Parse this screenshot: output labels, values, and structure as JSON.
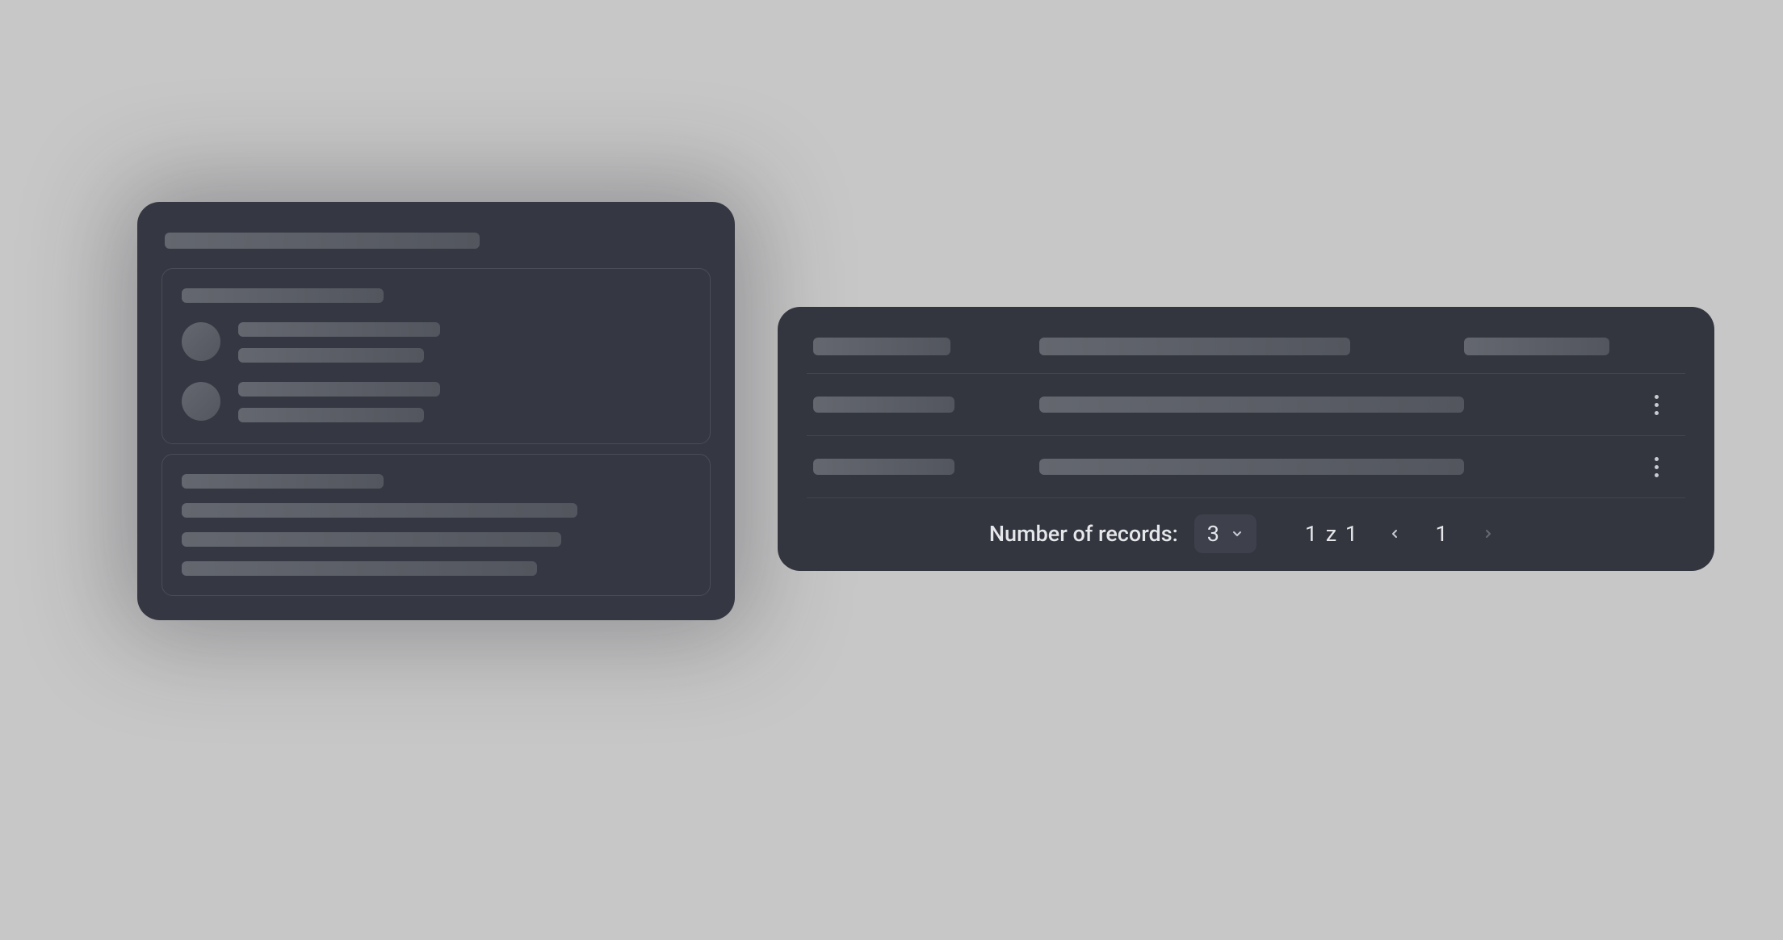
{
  "pager": {
    "label": "Number of records:",
    "page_size": "3",
    "range": "1 z 1",
    "current": "1"
  }
}
